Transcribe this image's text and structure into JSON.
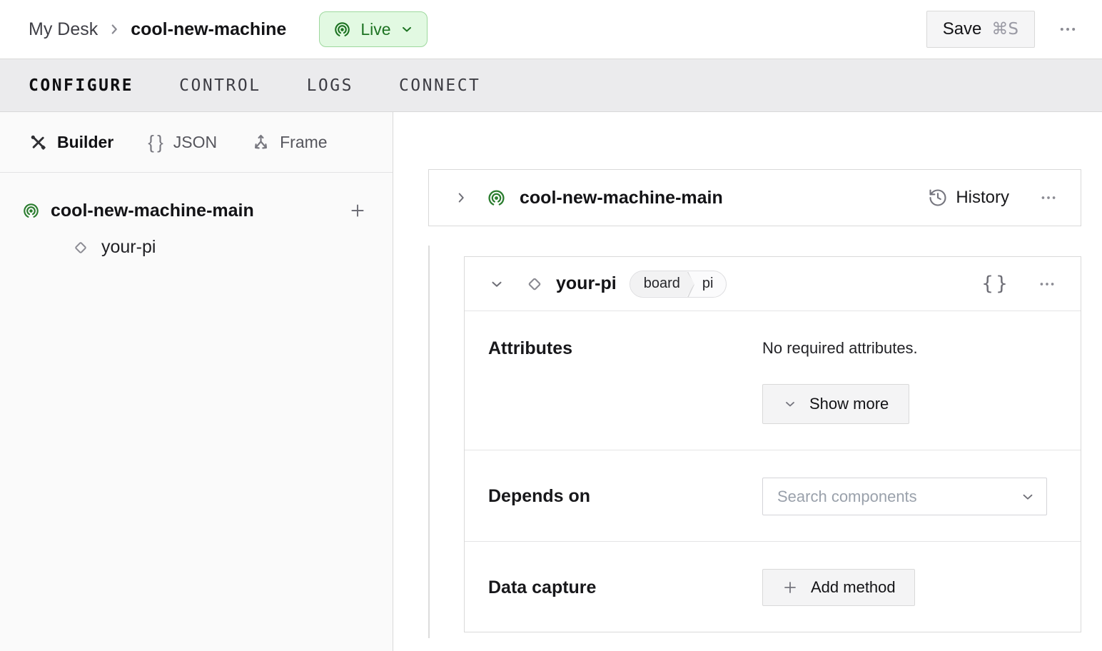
{
  "header": {
    "breadcrumb": {
      "parent": "My Desk",
      "current": "cool-new-machine"
    },
    "live_badge": {
      "label": "Live"
    },
    "save_button": {
      "label": "Save",
      "shortcut": "⌘S"
    }
  },
  "tabs": [
    {
      "label": "CONFIGURE",
      "active": true
    },
    {
      "label": "CONTROL",
      "active": false
    },
    {
      "label": "LOGS",
      "active": false
    },
    {
      "label": "CONNECT",
      "active": false
    }
  ],
  "sidebar": {
    "modes": [
      {
        "label": "Builder",
        "icon": "tools-icon",
        "active": true
      },
      {
        "label": "JSON",
        "icon": "braces-icon",
        "active": false
      },
      {
        "label": "Frame",
        "icon": "axes-icon",
        "active": false
      }
    ],
    "tree": {
      "part": {
        "label": "cool-new-machine-main",
        "icon": "broadcast-live-icon"
      },
      "component": {
        "label": "your-pi",
        "icon": "diamond-icon"
      }
    }
  },
  "main": {
    "part_card": {
      "title": "cool-new-machine-main",
      "history_label": "History"
    },
    "component_card": {
      "title": "your-pi",
      "type_badge": "board",
      "model_badge": "pi",
      "attributes": {
        "label": "Attributes",
        "empty_text": "No required attributes.",
        "show_more_label": "Show more"
      },
      "depends_on": {
        "label": "Depends on",
        "search_placeholder": "Search components"
      },
      "data_capture": {
        "label": "Data capture",
        "add_method_label": "Add method"
      }
    }
  },
  "icons": {
    "live": "broadcast-live-icon",
    "history": "clock-history-icon",
    "menu": "ellipsis-icon",
    "json_braces": "braces-icon",
    "component": "diamond-icon",
    "builder": "tools-icon",
    "frame": "axes-icon",
    "add": "plus-icon",
    "expand": "chevron-icon"
  },
  "colors": {
    "live_bg": "#e2f9e2",
    "live_border": "#9ed89e",
    "live_text": "#1d7322",
    "brand_green": "#2b7d2f",
    "tabbar_bg": "#ebebed",
    "sidebar_bg": "#fafafa",
    "card_border": "#d9d9d9",
    "button_bg": "#f4f4f5",
    "muted_icon": "#75757e"
  }
}
